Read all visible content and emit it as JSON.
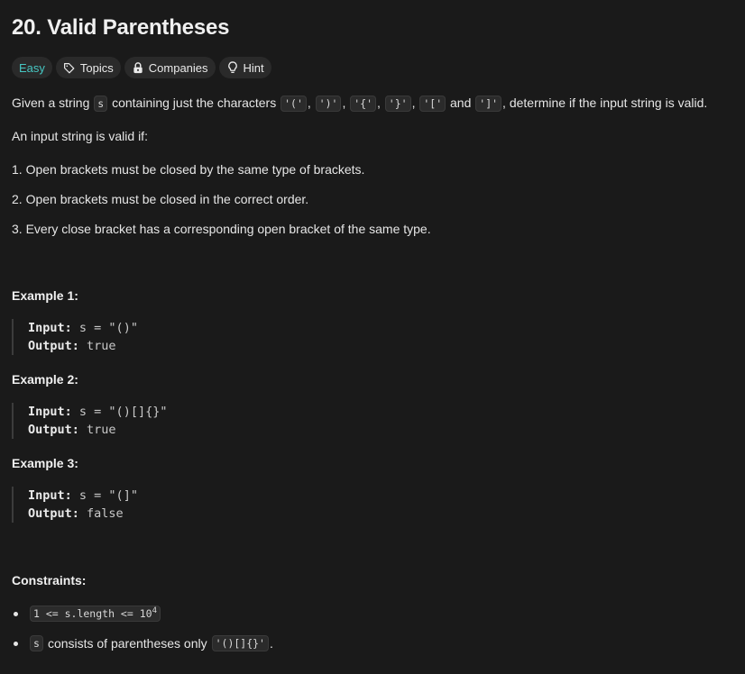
{
  "problem": {
    "title": "20. Valid Parentheses"
  },
  "tags": {
    "difficulty": "Easy",
    "topics": "Topics",
    "companies": "Companies",
    "hint": "Hint"
  },
  "description": {
    "intro_prefix": "Given a string",
    "intro_var": "s",
    "intro_mid": "containing just the characters",
    "chars": [
      "'('",
      "')'",
      "'{'",
      "'}'",
      "'['",
      "']'"
    ],
    "sep": ",",
    "and": "and",
    "intro_suffix": ", determine if the input string is valid.",
    "valid_if": "An input string is valid if:",
    "rules": [
      "1. Open brackets must be closed by the same type of brackets.",
      "2. Open brackets must be closed in the correct order.",
      "3. Every close bracket has a corresponding open bracket of the same type."
    ]
  },
  "examples": [
    {
      "heading": "Example 1:",
      "input_label": "Input:",
      "input_value": "s = \"()\"",
      "output_label": "Output:",
      "output_value": "true"
    },
    {
      "heading": "Example 2:",
      "input_label": "Input:",
      "input_value": "s = \"()[]{}\"",
      "output_label": "Output:",
      "output_value": "true"
    },
    {
      "heading": "Example 3:",
      "input_label": "Input:",
      "input_value": "s = \"(]\"",
      "output_label": "Output:",
      "output_value": "false"
    }
  ],
  "constraints": {
    "heading": "Constraints:",
    "c1_prefix": "1 <= s.length <= 10",
    "c1_exp": "4",
    "c2_var": "s",
    "c2_text": "consists of parentheses only",
    "c2_code": "'()[]{}'",
    "c2_end": "."
  },
  "icons": {
    "topics": "tag-icon",
    "companies": "lock-icon",
    "hint": "lightbulb-icon"
  },
  "colors": {
    "background": "#1a1a1a",
    "easy": "#46c6c2"
  }
}
